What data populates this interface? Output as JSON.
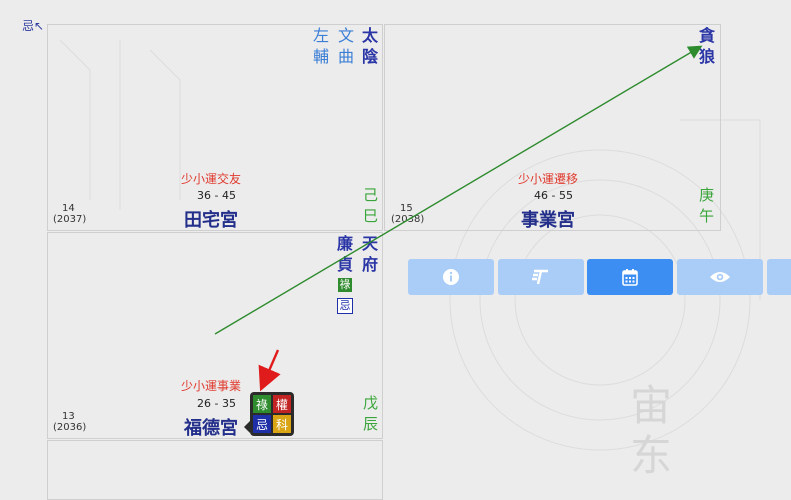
{
  "corner": {
    "label": "忌↖"
  },
  "palaces": {
    "tianzhai": {
      "stars_main": [
        "太",
        "陰"
      ],
      "stars_minor1": [
        "文",
        "曲"
      ],
      "stars_minor2": [
        "左",
        "輔"
      ],
      "xiao": "少小運交友",
      "range": "36 - 45",
      "age_num": "14",
      "age_year": "(2037)",
      "name": "田宅宮",
      "gan": "己",
      "zhi": "巳"
    },
    "shiye": {
      "stars_main": [
        "貪",
        "狼"
      ],
      "xiao": "少小運遷移",
      "range": "46 - 55",
      "age_num": "15",
      "age_year": "(2038)",
      "name": "事業宮",
      "gan": "庚",
      "zhi": "午"
    },
    "fude": {
      "stars_main1": [
        "廉",
        "貞"
      ],
      "stars_main2": [
        "天",
        "府"
      ],
      "badge_lu": "祿",
      "badge_ji": "忌",
      "xiao": "少小運事業",
      "range": "26 - 35",
      "age_num": "13",
      "age_year": "(2036)",
      "name": "福德宮",
      "gan": "戊",
      "zhi": "辰"
    }
  },
  "popup": {
    "lu": "祿",
    "quan": "權",
    "ji": "忌",
    "ke": "科"
  },
  "toolbar": [
    {
      "icon": "info-icon",
      "active": false
    },
    {
      "icon": "text-style-icon",
      "active": false
    },
    {
      "icon": "calendar-icon",
      "active": true
    },
    {
      "icon": "eye-icon",
      "active": false
    }
  ],
  "colors": {
    "lu": "#2e8b2e",
    "quan": "#c22323",
    "ji": "#1f2fa8",
    "ke": "#d9a514",
    "arrow_green": "#2e8b2e",
    "arrow_red": "#e01b1b"
  }
}
